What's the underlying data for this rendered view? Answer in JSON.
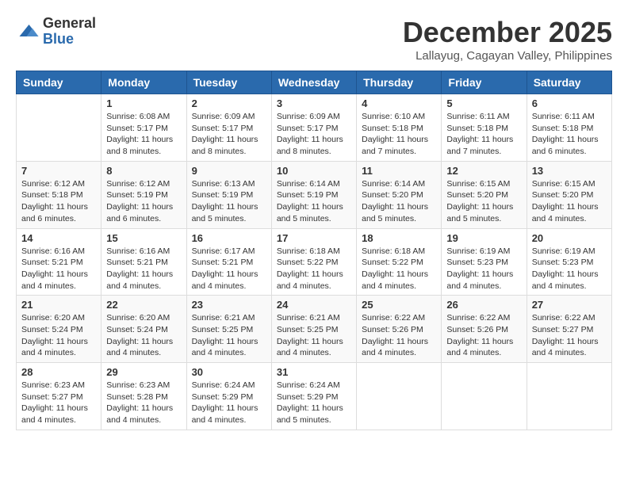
{
  "logo": {
    "general": "General",
    "blue": "Blue"
  },
  "title": "December 2025",
  "subtitle": "Lallayug, Cagayan Valley, Philippines",
  "days_of_week": [
    "Sunday",
    "Monday",
    "Tuesday",
    "Wednesday",
    "Thursday",
    "Friday",
    "Saturday"
  ],
  "weeks": [
    [
      {
        "day": "",
        "info": ""
      },
      {
        "day": "1",
        "info": "Sunrise: 6:08 AM\nSunset: 5:17 PM\nDaylight: 11 hours\nand 8 minutes."
      },
      {
        "day": "2",
        "info": "Sunrise: 6:09 AM\nSunset: 5:17 PM\nDaylight: 11 hours\nand 8 minutes."
      },
      {
        "day": "3",
        "info": "Sunrise: 6:09 AM\nSunset: 5:17 PM\nDaylight: 11 hours\nand 8 minutes."
      },
      {
        "day": "4",
        "info": "Sunrise: 6:10 AM\nSunset: 5:18 PM\nDaylight: 11 hours\nand 7 minutes."
      },
      {
        "day": "5",
        "info": "Sunrise: 6:11 AM\nSunset: 5:18 PM\nDaylight: 11 hours\nand 7 minutes."
      },
      {
        "day": "6",
        "info": "Sunrise: 6:11 AM\nSunset: 5:18 PM\nDaylight: 11 hours\nand 6 minutes."
      }
    ],
    [
      {
        "day": "7",
        "info": "Sunrise: 6:12 AM\nSunset: 5:18 PM\nDaylight: 11 hours\nand 6 minutes."
      },
      {
        "day": "8",
        "info": "Sunrise: 6:12 AM\nSunset: 5:19 PM\nDaylight: 11 hours\nand 6 minutes."
      },
      {
        "day": "9",
        "info": "Sunrise: 6:13 AM\nSunset: 5:19 PM\nDaylight: 11 hours\nand 5 minutes."
      },
      {
        "day": "10",
        "info": "Sunrise: 6:14 AM\nSunset: 5:19 PM\nDaylight: 11 hours\nand 5 minutes."
      },
      {
        "day": "11",
        "info": "Sunrise: 6:14 AM\nSunset: 5:20 PM\nDaylight: 11 hours\nand 5 minutes."
      },
      {
        "day": "12",
        "info": "Sunrise: 6:15 AM\nSunset: 5:20 PM\nDaylight: 11 hours\nand 5 minutes."
      },
      {
        "day": "13",
        "info": "Sunrise: 6:15 AM\nSunset: 5:20 PM\nDaylight: 11 hours\nand 4 minutes."
      }
    ],
    [
      {
        "day": "14",
        "info": "Sunrise: 6:16 AM\nSunset: 5:21 PM\nDaylight: 11 hours\nand 4 minutes."
      },
      {
        "day": "15",
        "info": "Sunrise: 6:16 AM\nSunset: 5:21 PM\nDaylight: 11 hours\nand 4 minutes."
      },
      {
        "day": "16",
        "info": "Sunrise: 6:17 AM\nSunset: 5:21 PM\nDaylight: 11 hours\nand 4 minutes."
      },
      {
        "day": "17",
        "info": "Sunrise: 6:18 AM\nSunset: 5:22 PM\nDaylight: 11 hours\nand 4 minutes."
      },
      {
        "day": "18",
        "info": "Sunrise: 6:18 AM\nSunset: 5:22 PM\nDaylight: 11 hours\nand 4 minutes."
      },
      {
        "day": "19",
        "info": "Sunrise: 6:19 AM\nSunset: 5:23 PM\nDaylight: 11 hours\nand 4 minutes."
      },
      {
        "day": "20",
        "info": "Sunrise: 6:19 AM\nSunset: 5:23 PM\nDaylight: 11 hours\nand 4 minutes."
      }
    ],
    [
      {
        "day": "21",
        "info": "Sunrise: 6:20 AM\nSunset: 5:24 PM\nDaylight: 11 hours\nand 4 minutes."
      },
      {
        "day": "22",
        "info": "Sunrise: 6:20 AM\nSunset: 5:24 PM\nDaylight: 11 hours\nand 4 minutes."
      },
      {
        "day": "23",
        "info": "Sunrise: 6:21 AM\nSunset: 5:25 PM\nDaylight: 11 hours\nand 4 minutes."
      },
      {
        "day": "24",
        "info": "Sunrise: 6:21 AM\nSunset: 5:25 PM\nDaylight: 11 hours\nand 4 minutes."
      },
      {
        "day": "25",
        "info": "Sunrise: 6:22 AM\nSunset: 5:26 PM\nDaylight: 11 hours\nand 4 minutes."
      },
      {
        "day": "26",
        "info": "Sunrise: 6:22 AM\nSunset: 5:26 PM\nDaylight: 11 hours\nand 4 minutes."
      },
      {
        "day": "27",
        "info": "Sunrise: 6:22 AM\nSunset: 5:27 PM\nDaylight: 11 hours\nand 4 minutes."
      }
    ],
    [
      {
        "day": "28",
        "info": "Sunrise: 6:23 AM\nSunset: 5:27 PM\nDaylight: 11 hours\nand 4 minutes."
      },
      {
        "day": "29",
        "info": "Sunrise: 6:23 AM\nSunset: 5:28 PM\nDaylight: 11 hours\nand 4 minutes."
      },
      {
        "day": "30",
        "info": "Sunrise: 6:24 AM\nSunset: 5:29 PM\nDaylight: 11 hours\nand 4 minutes."
      },
      {
        "day": "31",
        "info": "Sunrise: 6:24 AM\nSunset: 5:29 PM\nDaylight: 11 hours\nand 5 minutes."
      },
      {
        "day": "",
        "info": ""
      },
      {
        "day": "",
        "info": ""
      },
      {
        "day": "",
        "info": ""
      }
    ]
  ]
}
